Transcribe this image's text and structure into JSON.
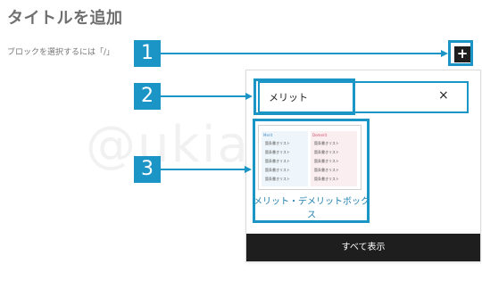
{
  "page": {
    "title": "タイトルを追加",
    "hint": "ブロックを選択するには「/」",
    "watermark": "@ukiasia"
  },
  "toolbar": {
    "add_label": "+"
  },
  "inserter": {
    "search_value": "メリット",
    "clear_label": "×",
    "result": {
      "label": "メリット・デメリットボックス",
      "preview": {
        "merit_heading": "Merit",
        "demerit_heading": "Demerit",
        "merit_items": [
          "箇条書きリスト",
          "箇条書きリスト",
          "箇条書きリスト",
          "箇条書きリスト",
          "箇条書きリスト"
        ],
        "demerit_items": [
          "箇条書きリスト",
          "箇条書きリスト",
          "箇条書きリスト",
          "箇条書きリスト",
          "箇条書きリスト"
        ]
      }
    },
    "show_all_label": "すべて表示"
  },
  "steps": [
    "1",
    "2",
    "3"
  ],
  "colors": {
    "accent": "#1b95c5",
    "dark": "#1e1e1e"
  }
}
